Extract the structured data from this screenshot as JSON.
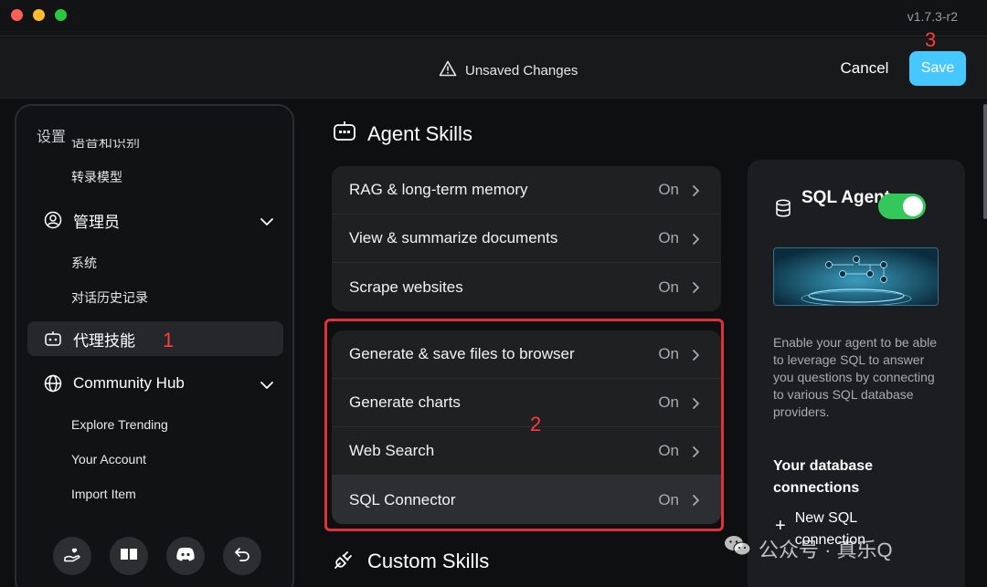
{
  "window": {
    "version": "v1.7.3-r2"
  },
  "header": {
    "unsaved_label": "Unsaved Changes",
    "cancel_label": "Cancel",
    "save_label": "Save"
  },
  "annotations": {
    "one": "1",
    "two": "2",
    "three": "3"
  },
  "sidebar": {
    "title": "设置",
    "cut_item": "语音和识别",
    "transcription": "转录模型",
    "admin": {
      "label": "管理员",
      "items": [
        "系统",
        "对话历史记录"
      ]
    },
    "agent_skills": "代理技能",
    "community": {
      "label": "Community Hub",
      "items": [
        "Explore Trending",
        "Your Account",
        "Import Item"
      ]
    }
  },
  "main": {
    "agent_title": "Agent Skills",
    "groups": [
      [
        {
          "label": "RAG & long-term memory",
          "state": "On"
        },
        {
          "label": "View & summarize documents",
          "state": "On"
        },
        {
          "label": "Scrape websites",
          "state": "On"
        }
      ],
      [
        {
          "label": "Generate & save files to browser",
          "state": "On"
        },
        {
          "label": "Generate charts",
          "state": "On"
        },
        {
          "label": "Web Search",
          "state": "On"
        },
        {
          "label": "SQL Connector",
          "state": "On"
        }
      ]
    ],
    "custom_title": "Custom Skills"
  },
  "panel": {
    "title": "SQL Agent",
    "enabled": true,
    "description": "Enable your agent to be able to leverage SQL to answer you questions by connecting to various SQL database providers.",
    "connections_title": "Your database connections",
    "new_connection": "New SQL connection"
  },
  "watermark": "公众号 · 真乐Q",
  "colors": {
    "accent": "#46c8ff",
    "toggle_on": "#34c759",
    "annotation": "#e0313b"
  }
}
